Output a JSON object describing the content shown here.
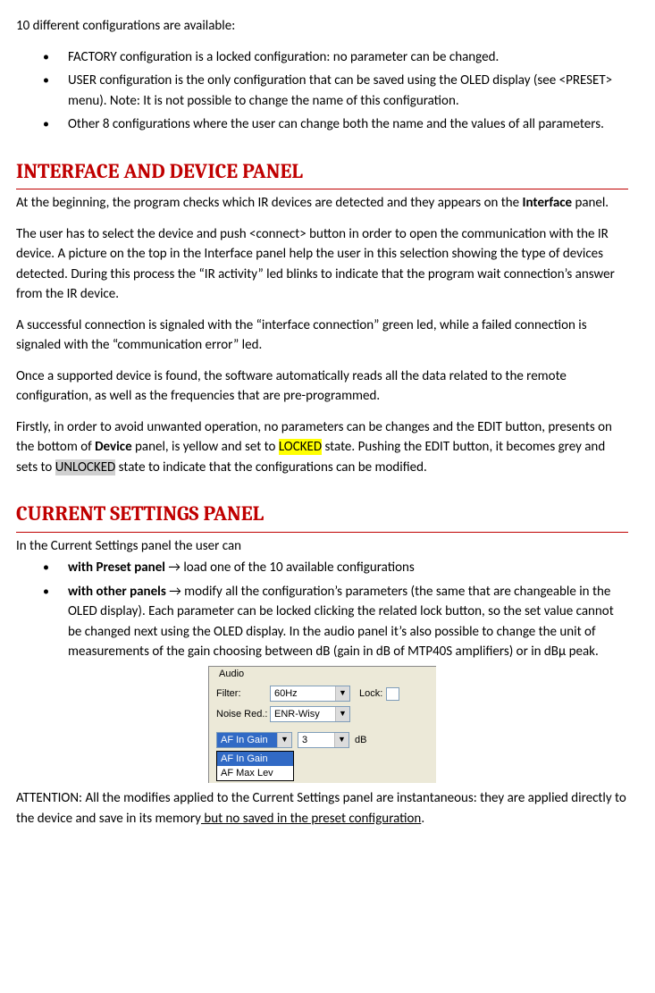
{
  "intro": "10 different configurations are available:",
  "configs": [
    "FACTORY configuration is a locked configuration: no parameter can be changed.",
    "USER configuration is the only configuration that can be saved using the OLED display (see <PRESET>  menu). Note: It is not possible to change the name of this configuration.",
    "Other 8 configurations where the user can change both the name and the values of all parameters."
  ],
  "heading1": "INTERFACE AND DEVICE PANEL",
  "p1a": "At the beginning, the program checks which IR devices are detected and they appears on the ",
  "p1b": "Interface",
  "p1c": " panel.",
  "p2": "The user has to select the device and push <connect> button in order to open the communication with the IR device. A picture on the top in the Interface panel help the user in this selection showing the type of devices detected. During this process the “IR activity” led blinks to indicate that the program wait connection’s answer from the IR device.",
  "p3": "A successful connection is signaled with the “interface connection” green led, while a failed connection is signaled with the “communication error” led.",
  "p4": "Once a supported device is found, the software automatically reads all the data related to the remote configuration, as well as the frequencies that are pre-programmed.",
  "p5a": "Firstly, in order to avoid unwanted operation, no parameters can be changes and the EDIT button, presents on the bottom of ",
  "p5b": "Device",
  "p5c": " panel, is yellow and set to ",
  "p5d": "LOCKED",
  "p5e": " state.  Pushing the EDIT button, it becomes grey and sets to ",
  "p5f": "UNLOCKED",
  "p5g": " state to indicate that the configurations can be modified.",
  "heading2": "CURRENT SETTINGS PANEL",
  "cs_intro": "In the Current Settings panel the user can",
  "cs1a": "with Preset panel",
  "cs1b": " → load one of the 10 available configurations",
  "cs2a": "with other panels",
  "cs2b": " → modify all the configuration’s parameters (the same that are changeable in the OLED display). Each parameter can be locked clicking the related lock button, so the set value cannot be changed next using the OLED display. In the audio panel it’s also possible to change the unit of measurements of the gain choosing between dB (gain in dB of MTP40S amplifiers) or in dBµ peak.",
  "audio": {
    "group": "Audio",
    "filter_label": "Filter:",
    "filter_value": "60Hz",
    "noise_label": "Noise Red.:",
    "noise_value": "ENR-Wisy",
    "lock_label": "Lock:",
    "gain_sel": "AF In Gain",
    "gain_value": "3",
    "gain_unit": "dB",
    "opts": [
      "AF In Gain",
      "AF Max Lev"
    ]
  },
  "attn_a": "ATTENTION: All the modifies applied to the Current Settings panel are instantaneous: they are applied directly to the device and save in its memory",
  "attn_b": " but no saved in the preset configuration",
  "attn_c": "."
}
